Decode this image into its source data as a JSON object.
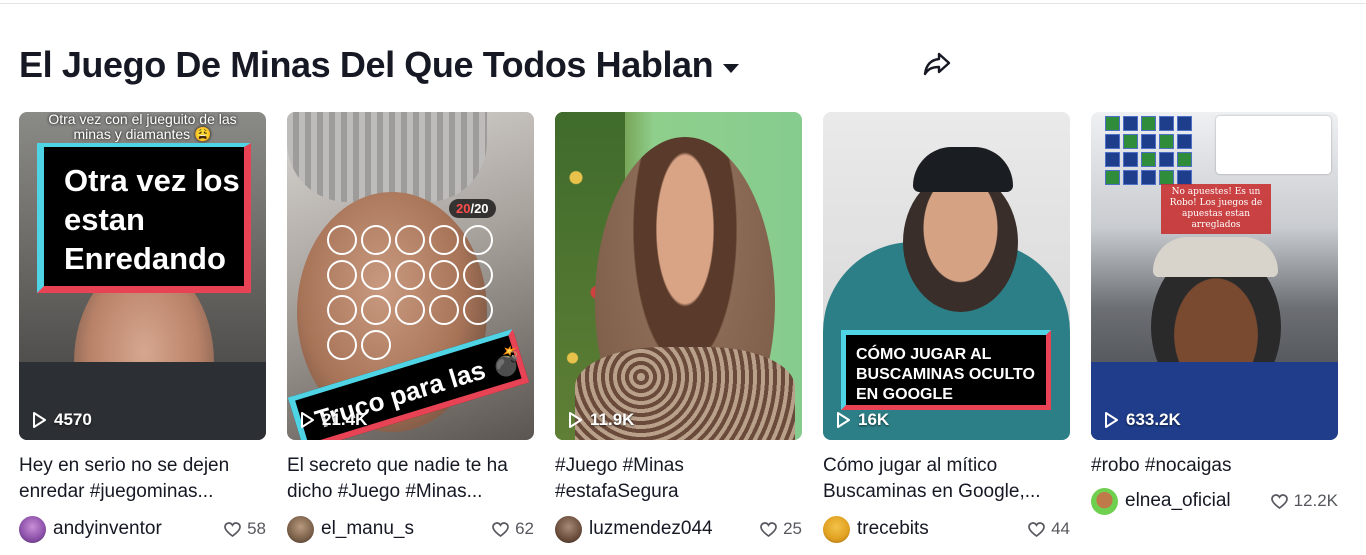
{
  "collection": {
    "title": "El Juego De Minas Del Que Todos Hablan",
    "dropdown_icon": "caret-down-icon",
    "share_icon": "share-arrow-icon"
  },
  "videos": [
    {
      "views": "4570",
      "caption": "Hey en serio no se dejen enredar #juegominas...",
      "author": "andyinventor",
      "likes": "58",
      "overlay_top": "Otra vez con el jueguito de las minas y diamantes 😩",
      "overlay_main": "Otra vez los estan Enredando"
    },
    {
      "views": "21.4K",
      "caption": "El secreto que nadie te ha dicho #Juego #Minas...",
      "author": "el_manu_s",
      "likes": "62",
      "overlay_counter_a": "20",
      "overlay_counter_b": "/20",
      "overlay_main": "Truco para las 💣"
    },
    {
      "views": "11.9K",
      "caption": "#Juego #Minas #estafaSegura",
      "author": "luzmendez044",
      "likes": "25"
    },
    {
      "views": "16K",
      "caption": "Cómo jugar al mítico Buscaminas en Google,...",
      "author": "trecebits",
      "likes": "44",
      "overlay_main": "CÓMO JUGAR AL BUSCAMINAS OCULTO EN GOOGLE"
    },
    {
      "views": "633.2K",
      "caption": "#robo #nocaigas",
      "author": "elnea_oficial",
      "likes": "12.2K",
      "overlay_main": "No apuestes! Es un Robo! Los juegos de apuestas estan arreglados"
    }
  ],
  "colors": {
    "text": "#161823",
    "muted": "#57585f",
    "accent_cyan": "#4fd4e6",
    "accent_red": "#e84355"
  }
}
